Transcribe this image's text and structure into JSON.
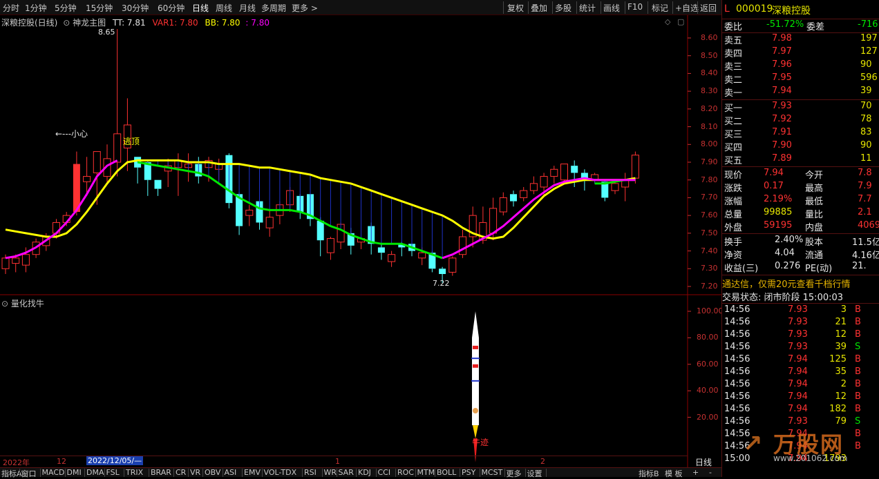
{
  "toolbar": {
    "periods": [
      "分时",
      "1分钟",
      "5分钟",
      "15分钟",
      "30分钟",
      "60分钟",
      "日线",
      "周线",
      "月线",
      "多周期",
      "更多 >"
    ],
    "active_period": "日线",
    "tools": [
      "复权",
      "叠加",
      "多股",
      "统计",
      "画线",
      "F10",
      "标记",
      "+自选",
      "返回"
    ]
  },
  "main_chart": {
    "title": "深粮控股(日线)",
    "indicator_name": "神龙主图",
    "tt_label": "TT: 7.81",
    "var1_label": "VAR1: 7.80",
    "bb_label": "BB: 7.80",
    "bb2_label": ": 7.80",
    "price_axis": [
      "8.60",
      "8.50",
      "8.40",
      "8.30",
      "8.20",
      "8.10",
      "8.00",
      "7.90",
      "7.80",
      "7.70",
      "7.60",
      "7.50",
      "7.40",
      "7.30",
      "7.20"
    ],
    "high_marker": "8.65",
    "low_marker": "7.22",
    "annotation_caution": "←---小心",
    "annotation_escape": "逃顶"
  },
  "sub_chart": {
    "title": "量化找牛",
    "axis": [
      "100.00",
      "80.00",
      "60.00",
      "40.00",
      "20.00"
    ],
    "annotation": "牛迹"
  },
  "date_axis": {
    "year": "2022年",
    "month1": "12",
    "cursor_date": "2022/12/05/—",
    "month2": "1",
    "month3": "2",
    "period_label": "日线"
  },
  "bottom_tabs": [
    "指标A",
    "窗口",
    "MACD",
    "DMI",
    "DMA",
    "FSL",
    "TRIX",
    "BRAR",
    "CR",
    "VR",
    "OBV",
    "ASI",
    "EMV",
    "VOL-TDX",
    "RSI",
    "WR",
    "SAR",
    "KDJ",
    "CCI",
    "ROC",
    "MTM",
    "BOLL",
    "PSY",
    "MCST",
    "更多",
    "设置"
  ],
  "bottom_right": [
    "指标B",
    "模 板",
    "+",
    "-"
  ],
  "quote_panel": {
    "prefix": "L",
    "code": "000019",
    "name": "深粮控股",
    "weibi_label": "委比",
    "weibi_value": "-51.72%",
    "weicha_label": "委差",
    "weicha_value": "-716",
    "asks": [
      {
        "label": "卖五",
        "price": "7.98",
        "vol": "197"
      },
      {
        "label": "卖四",
        "price": "7.97",
        "vol": "127"
      },
      {
        "label": "卖三",
        "price": "7.96",
        "vol": "90"
      },
      {
        "label": "卖二",
        "price": "7.95",
        "vol": "596"
      },
      {
        "label": "卖一",
        "price": "7.94",
        "vol": "39"
      }
    ],
    "bids": [
      {
        "label": "买一",
        "price": "7.93",
        "vol": "70"
      },
      {
        "label": "买二",
        "price": "7.92",
        "vol": "78"
      },
      {
        "label": "买三",
        "price": "7.91",
        "vol": "83"
      },
      {
        "label": "买四",
        "price": "7.90",
        "vol": "90"
      },
      {
        "label": "买五",
        "price": "7.89",
        "vol": "11"
      }
    ],
    "stats": [
      {
        "l1": "现价",
        "v1": "7.94",
        "c1": "red",
        "l2": "今开",
        "v2": "7.8"
      },
      {
        "l1": "涨跌",
        "v1": "0.17",
        "c1": "red",
        "l2": "最高",
        "v2": "7.9"
      },
      {
        "l1": "涨幅",
        "v1": "2.19%",
        "c1": "red",
        "l2": "最低",
        "v2": "7.7"
      },
      {
        "l1": "总量",
        "v1": "99885",
        "c1": "yellow",
        "l2": "量比",
        "v2": "2.1"
      },
      {
        "l1": "外盘",
        "v1": "59195",
        "c1": "red",
        "l2": "内盘",
        "v2": "4069"
      }
    ],
    "stats2": [
      {
        "l1": "换手",
        "v1": "2.40%",
        "l2": "股本",
        "v2": "11.5亿"
      },
      {
        "l1": "净资",
        "v1": "4.04",
        "l2": "流通",
        "v2": "4.16亿"
      },
      {
        "l1": "收益(三)",
        "v1": "0.276",
        "l2": "PE(动)",
        "v2": "21."
      }
    ],
    "ad_text": "通达信，仅需20元查看千档行情",
    "trade_status": "交易状态: 闭市阶段 15:00:03",
    "ticks": [
      {
        "time": "14:56",
        "price": "7.93",
        "vol": "3",
        "side": "B"
      },
      {
        "time": "14:56",
        "price": "7.93",
        "vol": "21",
        "side": "B"
      },
      {
        "time": "14:56",
        "price": "7.93",
        "vol": "12",
        "side": "B"
      },
      {
        "time": "14:56",
        "price": "7.93",
        "vol": "39",
        "side": "S"
      },
      {
        "time": "14:56",
        "price": "7.94",
        "vol": "125",
        "side": "B"
      },
      {
        "time": "14:56",
        "price": "7.94",
        "vol": "35",
        "side": "B"
      },
      {
        "time": "14:56",
        "price": "7.94",
        "vol": "2",
        "side": "B"
      },
      {
        "time": "14:56",
        "price": "7.94",
        "vol": "12",
        "side": "B"
      },
      {
        "time": "14:56",
        "price": "7.94",
        "vol": "182",
        "side": "B"
      },
      {
        "time": "14:56",
        "price": "7.93",
        "vol": "79",
        "side": "S"
      },
      {
        "time": "14:56",
        "price": "7.94",
        "vol": "",
        "side": "B"
      },
      {
        "time": "14:56",
        "price": "7.94",
        "vol": "",
        "side": "B"
      },
      {
        "time": "15:00",
        "price": "7.94",
        "vol": "1793",
        "side": ""
      }
    ],
    "watermark": "万股网",
    "watermark_url": "www.201062.com"
  },
  "colors": {
    "up": "#ff3232",
    "down": "#54ffff",
    "yellow_line": "#ffff00",
    "green_line": "#00e600",
    "magenta_line": "#ff00ff",
    "axis": "#c83232"
  },
  "candles": [
    {
      "o": 7.3,
      "c": 7.36,
      "h": 7.38,
      "l": 7.27
    },
    {
      "o": 7.33,
      "c": 7.36,
      "h": 7.38,
      "l": 7.28
    },
    {
      "o": 7.32,
      "c": 7.38,
      "h": 7.42,
      "l": 7.28
    },
    {
      "o": 7.38,
      "c": 7.45,
      "h": 7.47,
      "l": 7.36
    },
    {
      "o": 7.43,
      "c": 7.48,
      "h": 7.5,
      "l": 7.4
    },
    {
      "o": 7.5,
      "c": 7.56,
      "h": 7.58,
      "l": 7.47
    },
    {
      "o": 7.56,
      "c": 7.6,
      "h": 7.62,
      "l": 7.54
    },
    {
      "o": 7.62,
      "c": 7.89,
      "h": 7.96,
      "l": 7.6
    },
    {
      "o": 7.79,
      "c": 7.82,
      "h": 7.93,
      "l": 7.71
    },
    {
      "o": 7.84,
      "c": 7.96,
      "h": 7.96,
      "l": 7.66
    },
    {
      "o": 7.82,
      "c": 7.92,
      "h": 8.0,
      "l": 7.78
    },
    {
      "o": 7.9,
      "c": 8.06,
      "h": 8.65,
      "l": 7.82
    },
    {
      "o": 7.98,
      "c": 8.11,
      "h": 8.26,
      "l": 7.85
    },
    {
      "o": 7.93,
      "c": 7.87,
      "h": 7.93,
      "l": 7.78
    },
    {
      "o": 7.9,
      "c": 7.8,
      "h": 7.91,
      "l": 7.71
    },
    {
      "o": 7.8,
      "c": 7.75,
      "h": 7.8,
      "l": 7.71
    },
    {
      "o": 7.85,
      "c": 7.88,
      "h": 7.92,
      "l": 7.76
    },
    {
      "o": 7.87,
      "c": 7.91,
      "h": 7.95,
      "l": 7.71
    },
    {
      "o": 7.87,
      "c": 7.89,
      "h": 7.95,
      "l": 7.79
    },
    {
      "o": 7.89,
      "c": 7.82,
      "h": 7.93,
      "l": 7.78
    },
    {
      "o": 7.87,
      "c": 7.91,
      "h": 7.93,
      "l": 7.79
    },
    {
      "o": 7.86,
      "c": 7.89,
      "h": 7.92,
      "l": 7.8
    },
    {
      "o": 7.94,
      "c": 7.67,
      "h": 7.95,
      "l": 7.64
    },
    {
      "o": 7.72,
      "c": 7.54,
      "h": 7.73,
      "l": 7.49
    },
    {
      "o": 7.6,
      "c": 7.63,
      "h": 7.66,
      "l": 7.54
    },
    {
      "o": 7.68,
      "c": 7.56,
      "h": 7.7,
      "l": 7.52
    },
    {
      "o": 7.53,
      "c": 7.59,
      "h": 7.63,
      "l": 7.48
    },
    {
      "o": 7.6,
      "c": 7.66,
      "h": 7.68,
      "l": 7.55
    },
    {
      "o": 7.66,
      "c": 7.74,
      "h": 7.76,
      "l": 7.62
    },
    {
      "o": 7.71,
      "c": 7.62,
      "h": 7.72,
      "l": 7.58
    },
    {
      "o": 7.72,
      "c": 7.58,
      "h": 7.73,
      "l": 7.54
    },
    {
      "o": 7.57,
      "c": 7.46,
      "h": 7.59,
      "l": 7.37
    },
    {
      "o": 7.39,
      "c": 7.47,
      "h": 7.48,
      "l": 7.35
    },
    {
      "o": 7.45,
      "c": 7.55,
      "h": 7.56,
      "l": 7.41
    },
    {
      "o": 7.5,
      "c": 7.43,
      "h": 7.53,
      "l": 7.38
    },
    {
      "o": 7.45,
      "c": 7.47,
      "h": 7.49,
      "l": 7.41
    },
    {
      "o": 7.54,
      "c": 7.44,
      "h": 7.56,
      "l": 7.38
    },
    {
      "o": 7.42,
      "c": 7.39,
      "h": 7.44,
      "l": 7.35
    },
    {
      "o": 7.34,
      "c": 7.38,
      "h": 7.4,
      "l": 7.31
    },
    {
      "o": 7.44,
      "c": 7.42,
      "h": 7.45,
      "l": 7.37
    },
    {
      "o": 7.44,
      "c": 7.4,
      "h": 7.45,
      "l": 7.37
    },
    {
      "o": 7.36,
      "c": 7.39,
      "h": 7.42,
      "l": 7.32
    },
    {
      "o": 7.39,
      "c": 7.3,
      "h": 7.4,
      "l": 7.28
    },
    {
      "o": 7.3,
      "c": 7.27,
      "h": 7.31,
      "l": 7.22
    },
    {
      "o": 7.28,
      "c": 7.36,
      "h": 7.37,
      "l": 7.26
    },
    {
      "o": 7.38,
      "c": 7.48,
      "h": 7.52,
      "l": 7.36
    },
    {
      "o": 7.48,
      "c": 7.6,
      "h": 7.65,
      "l": 7.42
    },
    {
      "o": 7.46,
      "c": 7.56,
      "h": 7.65,
      "l": 7.44
    },
    {
      "o": 7.5,
      "c": 7.64,
      "h": 7.7,
      "l": 7.46
    },
    {
      "o": 7.62,
      "c": 7.7,
      "h": 7.73,
      "l": 7.6
    },
    {
      "o": 7.72,
      "c": 7.68,
      "h": 7.74,
      "l": 7.65
    },
    {
      "o": 7.7,
      "c": 7.74,
      "h": 7.76,
      "l": 7.68
    },
    {
      "o": 7.74,
      "c": 7.78,
      "h": 7.82,
      "l": 7.72
    },
    {
      "o": 7.76,
      "c": 7.82,
      "h": 7.84,
      "l": 7.71
    },
    {
      "o": 7.82,
      "c": 7.86,
      "h": 7.88,
      "l": 7.78
    },
    {
      "o": 7.8,
      "c": 7.89,
      "h": 7.89,
      "l": 7.79
    },
    {
      "o": 7.88,
      "c": 7.84,
      "h": 7.91,
      "l": 7.76
    },
    {
      "o": 7.84,
      "c": 7.81,
      "h": 7.86,
      "l": 7.74
    },
    {
      "o": 7.8,
      "c": 7.83,
      "h": 7.84,
      "l": 7.78
    },
    {
      "o": 7.79,
      "c": 7.7,
      "h": 7.8,
      "l": 7.68
    },
    {
      "o": 7.74,
      "c": 7.78,
      "h": 7.8,
      "l": 7.72
    },
    {
      "o": 7.76,
      "c": 7.8,
      "h": 7.84,
      "l": 7.68
    },
    {
      "o": 7.81,
      "c": 7.94,
      "h": 7.96,
      "l": 7.78
    }
  ],
  "ma_yellow": [
    7.52,
    7.51,
    7.5,
    7.49,
    7.48,
    7.48,
    7.5,
    7.55,
    7.62,
    7.7,
    7.78,
    7.85,
    7.9,
    7.91,
    7.91,
    7.91,
    7.91,
    7.91,
    7.9,
    7.9,
    7.9,
    7.89,
    7.89,
    7.89,
    7.88,
    7.87,
    7.87,
    7.86,
    7.85,
    7.84,
    7.83,
    7.81,
    7.8,
    7.79,
    7.78,
    7.76,
    7.74,
    7.72,
    7.7,
    7.68,
    7.66,
    7.64,
    7.62,
    7.6,
    7.57,
    7.53,
    7.5,
    7.48,
    7.47,
    7.48,
    7.53,
    7.59,
    7.65,
    7.71,
    7.75,
    7.78,
    7.79,
    7.8,
    7.8,
    7.8,
    7.8,
    7.8,
    7.81
  ],
  "ma_green": [
    null,
    null,
    null,
    null,
    null,
    null,
    null,
    null,
    null,
    null,
    null,
    null,
    null,
    7.9,
    7.89,
    7.88,
    7.87,
    7.86,
    7.85,
    7.84,
    7.82,
    7.78,
    7.74,
    7.7,
    7.67,
    7.64,
    7.63,
    7.63,
    7.63,
    7.62,
    7.6,
    7.57,
    7.54,
    7.52,
    7.49,
    7.47,
    7.45,
    7.44,
    7.44,
    7.44,
    7.42,
    7.4,
    7.38,
    7.36,
    null,
    null,
    null,
    null,
    null,
    null,
    null,
    null,
    null,
    null,
    null,
    null,
    null,
    null,
    7.78,
    7.78,
    7.79,
    7.8,
    7.8
  ],
  "ma_magenta": [
    7.36,
    7.37,
    7.39,
    7.42,
    7.46,
    7.5,
    7.56,
    7.63,
    7.72,
    7.82,
    7.88,
    7.91,
    null,
    null,
    null,
    null,
    null,
    null,
    null,
    null,
    null,
    null,
    null,
    null,
    null,
    null,
    null,
    null,
    null,
    null,
    null,
    null,
    null,
    null,
    null,
    null,
    null,
    null,
    null,
    null,
    null,
    null,
    null,
    7.36,
    7.38,
    7.41,
    7.44,
    7.47,
    7.5,
    7.54,
    7.59,
    7.64,
    7.69,
    7.73,
    7.77,
    7.79,
    7.8,
    7.81,
    7.8,
    7.8,
    7.8,
    7.8,
    7.8
  ]
}
